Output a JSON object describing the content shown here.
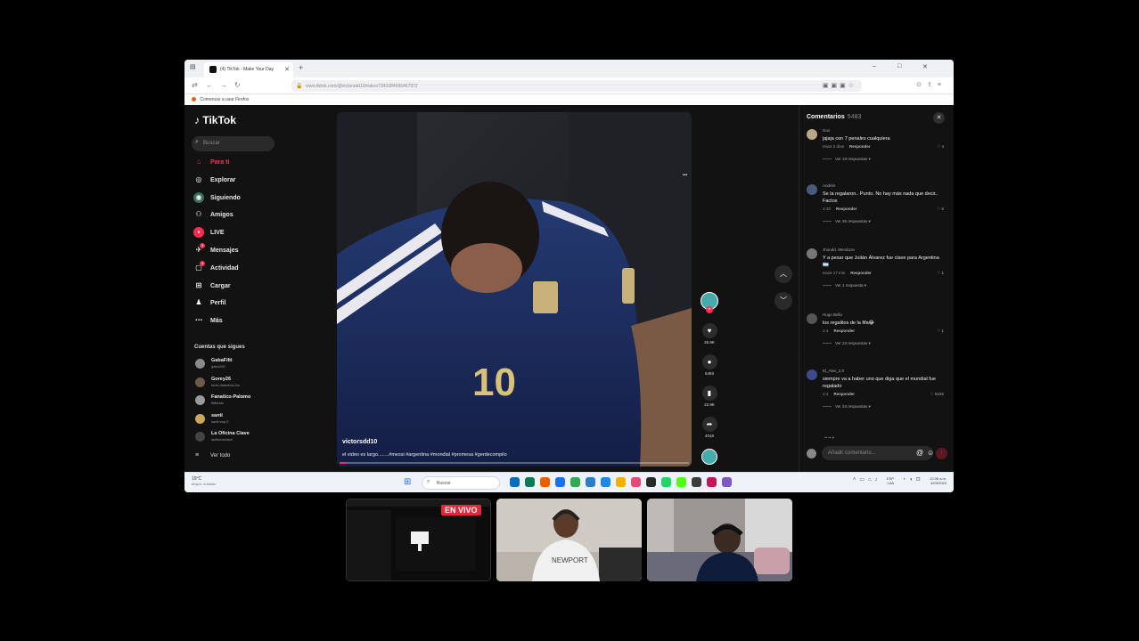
{
  "browser": {
    "tab_title": "(4) TikTok - Make Your Day",
    "new_tab": "+",
    "url": "www.tiktok.com/@victorsdd10/video/7341084996467972",
    "bookmark": "Comenzar a usar Firefox",
    "window_controls": [
      "–",
      "□",
      "✕"
    ]
  },
  "sidebar": {
    "logo": "TikTok",
    "search_placeholder": "Buscar",
    "nav": [
      {
        "label": "Para ti",
        "icon": "home-icon",
        "glyph": "⌂",
        "active": true
      },
      {
        "label": "Explorar",
        "icon": "compass-icon",
        "glyph": "◎"
      },
      {
        "label": "Siguiendo",
        "icon": "following-icon",
        "glyph": "◉"
      },
      {
        "label": "Amigos",
        "icon": "friends-icon",
        "glyph": "⚇"
      },
      {
        "label": "LIVE",
        "icon": "live-icon",
        "glyph": "●"
      },
      {
        "label": "Mensajes",
        "icon": "messages-icon",
        "glyph": "✈",
        "badge": "1"
      },
      {
        "label": "Actividad",
        "icon": "activity-icon",
        "glyph": "▢",
        "badge": "1"
      },
      {
        "label": "Cargar",
        "icon": "upload-icon",
        "glyph": "⊞"
      },
      {
        "label": "Perfil",
        "icon": "profile-icon",
        "glyph": "♟"
      },
      {
        "label": "Más",
        "icon": "more-icon",
        "glyph": "⋯"
      }
    ],
    "following_header": "Cuentas que sigues",
    "accounts": [
      {
        "name": "GabaFilti",
        "handle": "gabu100"
      },
      {
        "name": "Gorey26",
        "handle": "facts.diabolica.fun"
      },
      {
        "name": "Fanatico-Palomo",
        "handle": "fitifunds"
      },
      {
        "name": "santi",
        "handle": "santi.esp.0"
      },
      {
        "name": "La Oficina Clave",
        "handle": "laoficinaclave"
      }
    ],
    "see_all": "Ver todo"
  },
  "video": {
    "username": "victorsdd10",
    "caption": "el video es largo........#messi #argentina #mondial #promesa #gerdecompilo",
    "more": "•••",
    "progress": 0.02
  },
  "actions": {
    "likes": "26.9K",
    "comments": "5483",
    "saves": "22.9K",
    "shares": "4016"
  },
  "comments": {
    "title": "Comentarios",
    "count": "5483",
    "items": [
      {
        "user": "Gus",
        "text": "jajaja con 7 penales cualquiera",
        "time": "Hace 2 días",
        "likes": "4",
        "replies": "Ver 19 respuestas"
      },
      {
        "user": "Andrés",
        "text": "Se la regalaron.. Punto. No hay más nada que decir.. Factos",
        "time": "1-10",
        "likes": "0",
        "replies": "Ver 35 respuestas"
      },
      {
        "user": "Jhondd. Mendoza",
        "text": "Y a pesar que Julián Álvarez fue clave para Argentina 🇦🇷",
        "time": "Hace 17 min",
        "likes": "1",
        "replies": "Ver 1 respuesta"
      },
      {
        "user": "Hugo Bello",
        "text": "los regalitos de la fifa😂",
        "time": "1-1",
        "likes": "1",
        "replies": "Ver 23 respuestas"
      },
      {
        "user": "El_Alex_2.0",
        "text": "siempre va a haber uno que diga que el mundial fue regalado",
        "time": "1-1",
        "likes": "5182",
        "replies": "Ver 34 respuestas"
      }
    ],
    "reply_label": "Responder",
    "input_placeholder": "Añadir comentario...",
    "truncated": "•• •• ▾"
  },
  "taskbar": {
    "weather_temp": "19°C",
    "weather_desc": "Mayor. nublado",
    "search_label": "Buscar",
    "lang1": "ESP",
    "lang2": "LAA",
    "time": "12:36 a.m.",
    "date": "4/03/2024"
  },
  "stream": {
    "live_label": "EN VIVO"
  },
  "colors": {
    "accent": "#fe2c55",
    "background": "#121212",
    "live_badge": "#e8263a"
  }
}
